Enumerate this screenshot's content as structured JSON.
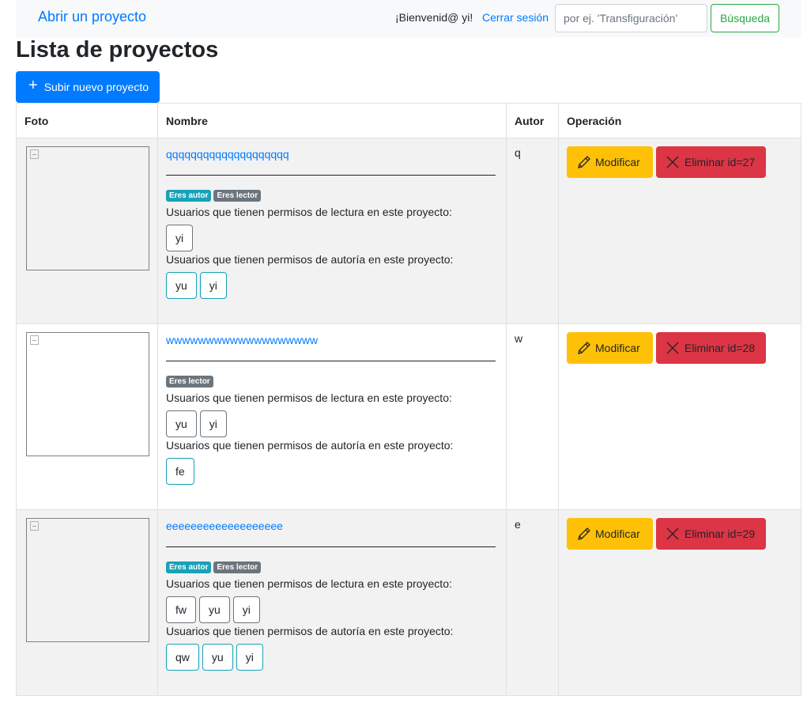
{
  "navbar": {
    "brand": "Abrir un proyecto",
    "welcome": "¡Bienvenid@ yi!",
    "logout": "Cerrar sesión",
    "search_placeholder": "por ej. 'Transfiguración'",
    "search_button": "Búsqueda"
  },
  "page": {
    "title": "Lista de proyectos",
    "upload_button": "Subir nuevo proyecto"
  },
  "table": {
    "headers": [
      "Foto",
      "Nombre",
      "Autor",
      "Operación"
    ],
    "read_perm_text": "Usuarios que tienen permisos de lectura en este proyecto:",
    "author_perm_text": "Usuarios que tienen permisos de autoría en este proyecto:",
    "modify_label": "Modificar",
    "badge_author": "Eres autor",
    "badge_reader": "Eres lector",
    "rows": [
      {
        "name": "qqqqqqqqqqqqqqqqqqqq",
        "author": "q",
        "delete_label": "Eliminar id=27",
        "readers": [
          "yi"
        ],
        "authors": [
          "yu",
          "yi"
        ]
      },
      {
        "name": "wwwwwwwwwwwwwwwwwww",
        "author": "w",
        "delete_label": "Eliminar id=28",
        "readers": [
          "yu",
          "yi"
        ],
        "authors": [
          "fe"
        ]
      },
      {
        "name": "eeeeeeeeeeeeeeeeeee",
        "author": "e",
        "delete_label": "Eliminar id=29",
        "readers": [
          "fw",
          "yu",
          "yi"
        ],
        "authors": [
          "qw",
          "yu",
          "yi"
        ]
      }
    ]
  },
  "colors": {
    "primary": "#007bff",
    "success": "#28a745",
    "warning": "#ffc107",
    "danger": "#dc3545",
    "info": "#17a2b8",
    "secondary": "#6c757d"
  }
}
